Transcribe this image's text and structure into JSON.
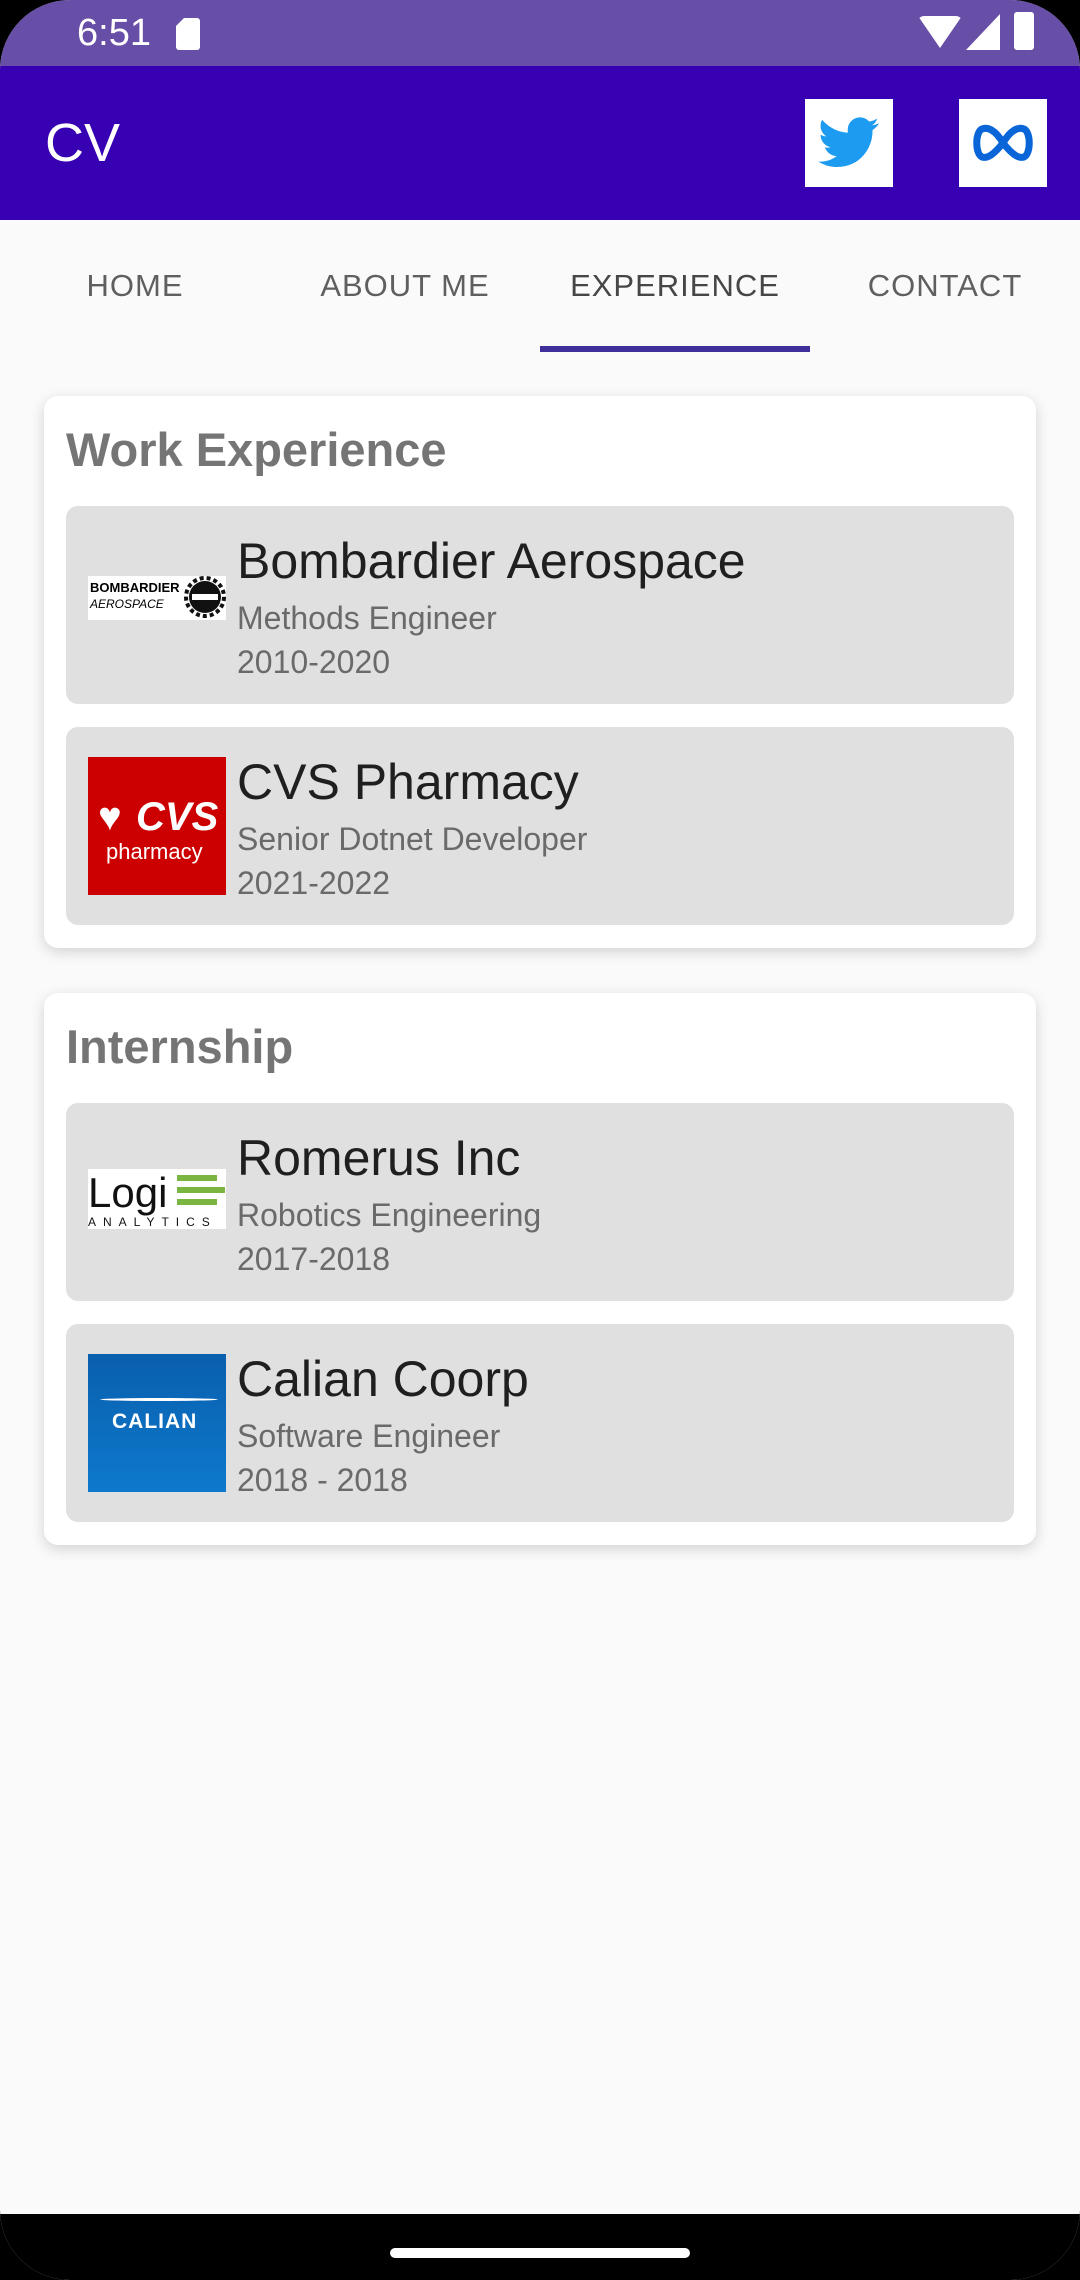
{
  "status": {
    "time": "6:51"
  },
  "appbar": {
    "title": "CV",
    "twitter_icon": "twitter-bird-icon",
    "meta_icon": "meta-infinity-icon",
    "accent": "#3700b3"
  },
  "tabs": [
    {
      "label": "HOME"
    },
    {
      "label": "ABOUT ME"
    },
    {
      "label": "EXPERIENCE"
    },
    {
      "label": "CONTACT"
    }
  ],
  "work": {
    "title": "Work Experience",
    "items": [
      {
        "company": "Bombardier Aerospace",
        "role": "Methods Engineer",
        "years": "2010-2020",
        "logo_text_1": "BOMBARDIER",
        "logo_text_2": "AEROSPACE"
      },
      {
        "company": "CVS Pharmacy",
        "role": "Senior Dotnet Developer",
        "years": "2021-2022",
        "logo_text_1": "CVS",
        "logo_text_2": "pharmacy"
      }
    ]
  },
  "internship": {
    "title": "Internship",
    "items": [
      {
        "company": "Romerus Inc",
        "role": "Robotics Engineering",
        "years": "2017-2018",
        "logo_text_1": "Logi",
        "logo_text_2": "ANALYTICS"
      },
      {
        "company": "Calian Coorp",
        "role": "Software Engineer",
        "years": "2018 - 2018",
        "logo_text_1": "CALIAN"
      }
    ]
  }
}
